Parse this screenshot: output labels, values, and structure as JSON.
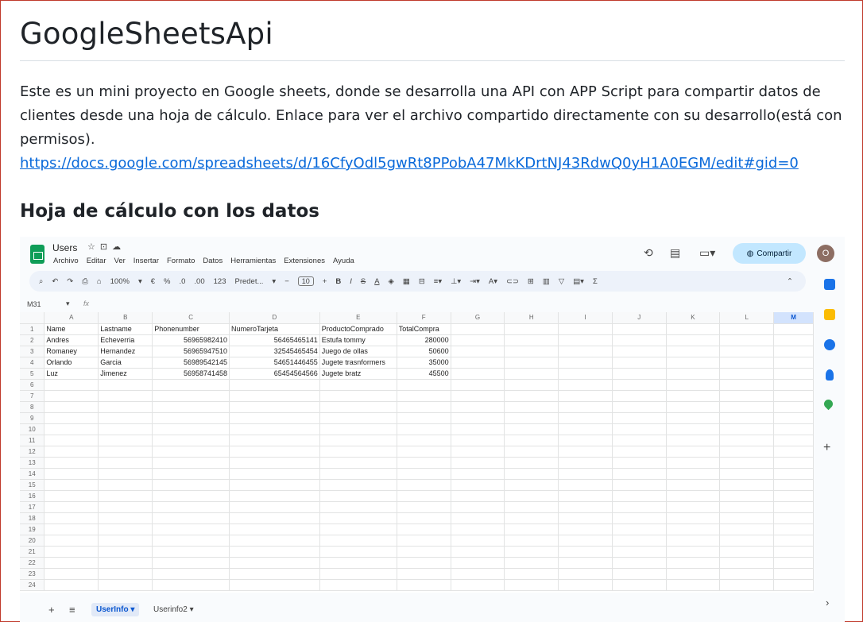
{
  "page": {
    "title": "GoogleSheetsApi",
    "intro": "Este es un mini proyecto en Google sheets, donde se desarrolla una API con APP Script para compartir datos de clientes desde una hoja de cálculo. Enlace para ver el archivo compartido directamente con su desarrollo(está con permisos).",
    "link": "https://docs.google.com/spreadsheets/d/16CfyOdl5gwRt8PPobA47MkKDrtNJ43RdwQ0yH1A0EGM/edit#gid=0",
    "subtitle": "Hoja de cálculo con los datos"
  },
  "sheet": {
    "doc_title": "Users",
    "menu": [
      "Archivo",
      "Editar",
      "Ver",
      "Insertar",
      "Formato",
      "Datos",
      "Herramientas",
      "Extensiones",
      "Ayuda"
    ],
    "share_label": "Compartir",
    "avatar_initial": "O",
    "toolbar": {
      "zoom": "100%",
      "currency": "€",
      "percent": "%",
      "dec_decrease": ".0",
      "dec_increase": ".00",
      "format_123": "123",
      "font": "Predet...",
      "font_size": "10",
      "bold": "B",
      "italic": "I",
      "strike": "S",
      "text_color": "A",
      "sigma": "Σ"
    },
    "name_box": "M31",
    "fx": "fx",
    "columns": [
      "A",
      "B",
      "C",
      "D",
      "E",
      "F",
      "G",
      "H",
      "I",
      "J",
      "K",
      "L",
      "M"
    ],
    "headers": [
      "Name",
      "Lastname",
      "Phonenumber",
      "NumeroTarjeta",
      "ProductoComprado",
      "TotalCompra"
    ],
    "rows": [
      [
        "Andres",
        "Echeverria",
        "56965982410",
        "56465465141",
        "Estufa tommy",
        "280000"
      ],
      [
        "Romaney",
        "Hernandez",
        "56965947510",
        "32545465454",
        "Juego de ollas",
        "50600"
      ],
      [
        "Orlando",
        "Garcia",
        "56989542145",
        "54651446455",
        "Jugete trasnformers",
        "35000"
      ],
      [
        "Luz",
        "Jimenez",
        "56958741458",
        "65454564566",
        "Jugete bratz",
        "45500"
      ]
    ],
    "row_count": 24,
    "tabs": [
      "UserInfo",
      "Userinfo2"
    ]
  }
}
